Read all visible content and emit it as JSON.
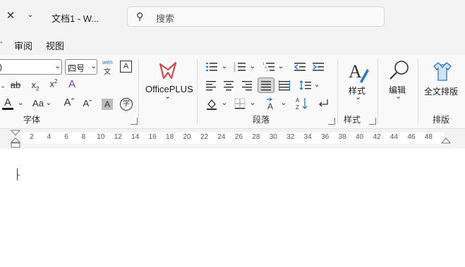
{
  "titlebar": {
    "doc_title": "文档1  -  W...",
    "search_placeholder": "搜索"
  },
  "menubar": {
    "review": "审阅",
    "view": "视图"
  },
  "font": {
    "size_value": "四号",
    "pinyin_top": "wén",
    "pinyin_bottom": "文",
    "group_label": "字体"
  },
  "officeplus": {
    "label": "OfficePLUS"
  },
  "paragraph": {
    "group_label": "段落"
  },
  "styles": {
    "button_label": "样式",
    "group_label": "样式"
  },
  "editing": {
    "label": "编辑"
  },
  "layout": {
    "label": "全文排版",
    "group_label": "排版"
  },
  "ruler": {
    "ticks": [
      "2",
      "4",
      "6",
      "8",
      "10",
      "12",
      "14",
      "16",
      "18",
      "20",
      "22",
      "24",
      "26",
      "28",
      "30",
      "32",
      "34",
      "36",
      "38",
      "40",
      "42",
      "44",
      "46",
      "48"
    ]
  },
  "colors": {
    "accent": "#2b78c5",
    "officeplus_red": "#e23a3a",
    "text_color_bar": "#1f1f1f"
  }
}
